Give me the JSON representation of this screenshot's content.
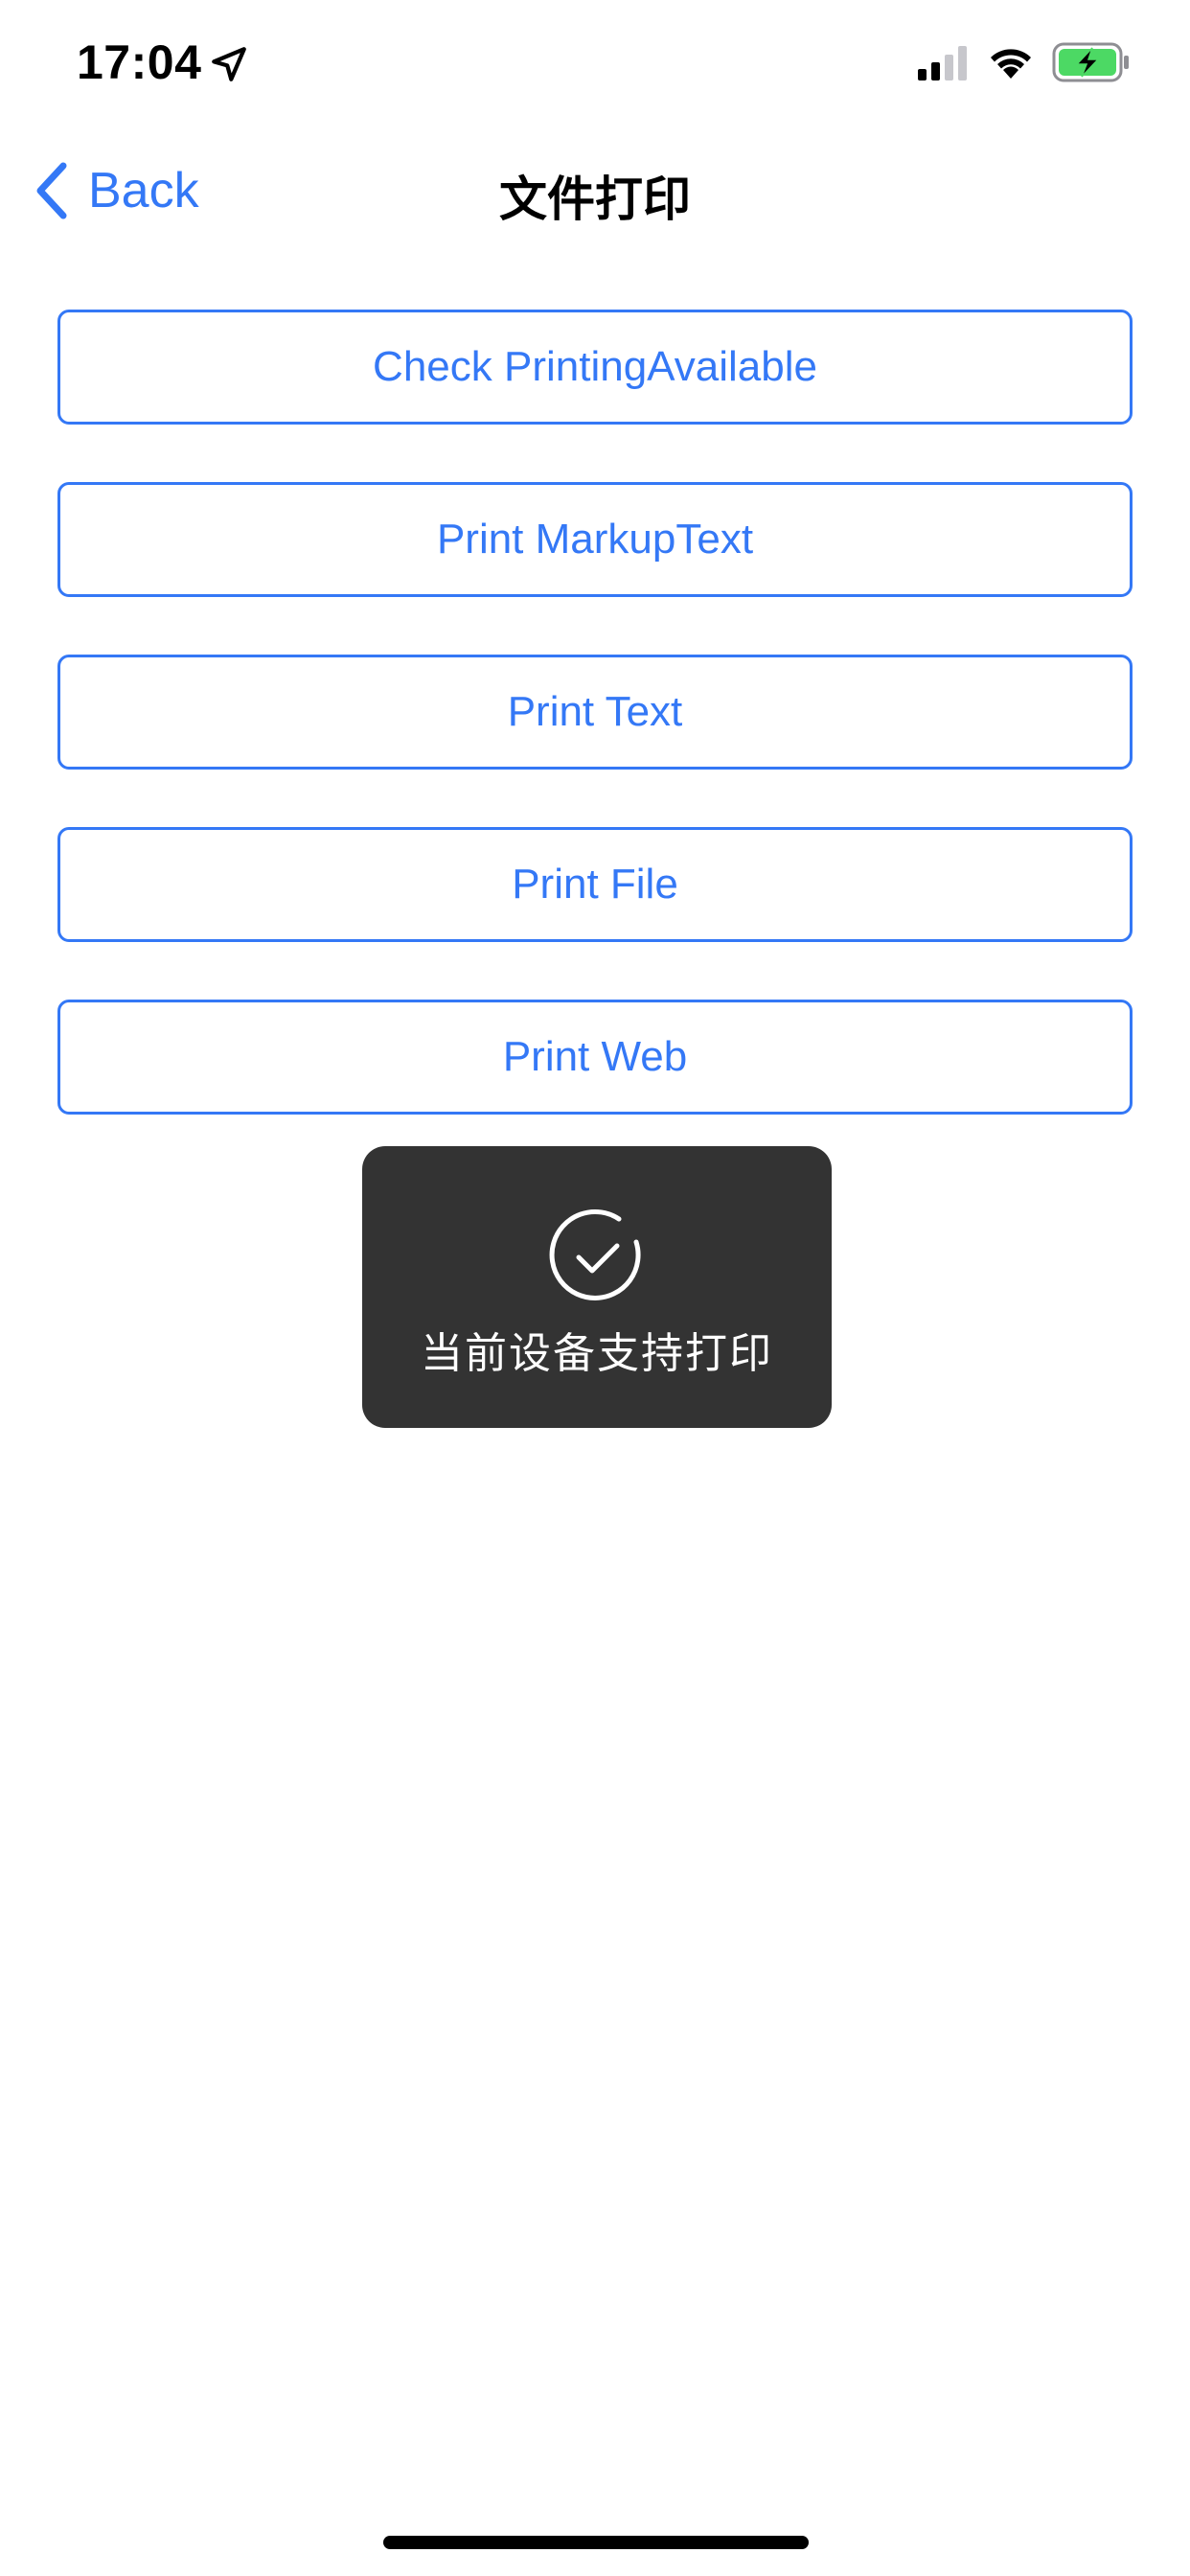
{
  "status_bar": {
    "time": "17:04",
    "location_icon": "location-arrow-icon",
    "signal_icon": "cellular-signal-icon",
    "wifi_icon": "wifi-icon",
    "battery_icon": "battery-charging-icon",
    "battery_color": "#4cd964"
  },
  "nav": {
    "back_label": "Back",
    "back_icon": "chevron-left-icon",
    "title": "文件打印"
  },
  "buttons": [
    {
      "label": "Check PrintingAvailable"
    },
    {
      "label": "Print MarkupText"
    },
    {
      "label": "Print Text"
    },
    {
      "label": "Print File"
    },
    {
      "label": "Print Web"
    }
  ],
  "toast": {
    "icon": "checkmark-circle-icon",
    "message": "当前设备支持打印"
  },
  "colors": {
    "accent": "#3478f6",
    "toast_background": "#333333",
    "background": "#ffffff"
  }
}
